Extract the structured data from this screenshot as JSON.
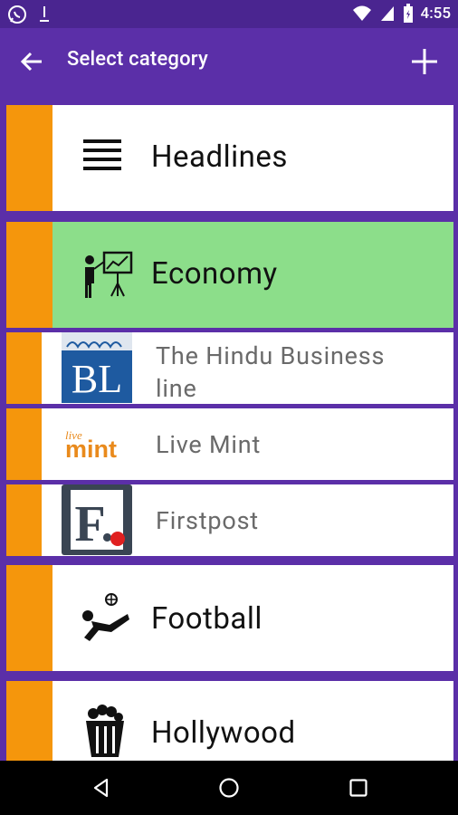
{
  "status_bar": {
    "time": "4:55",
    "icons": [
      "whatsapp-icon",
      "download-icon",
      "wifi-icon",
      "signal-icon",
      "battery-icon"
    ]
  },
  "app_bar": {
    "title": "Select category",
    "back_icon": "arrow-left-icon",
    "add_icon": "plus-icon"
  },
  "colors": {
    "primary": "#5b2fa8",
    "status_bar": "#4a2590",
    "accent_bar": "#f5960c",
    "selected_bg": "#8cde8a"
  },
  "categories": [
    {
      "label": "Headlines",
      "icon": "list-lines-icon"
    },
    {
      "label": "Economy",
      "icon": "presenter-chart-icon",
      "selected": true
    },
    {
      "label": "Football",
      "icon": "football-kick-icon"
    },
    {
      "label": "Hollywood",
      "icon": "popcorn-icon"
    }
  ],
  "sources": [
    {
      "label": "The Hindu Business line",
      "logo": "BL",
      "logo_name": "hindu-businessline-logo"
    },
    {
      "label": "Live Mint",
      "logo": "mint",
      "logo_small": "live",
      "logo_name": "livemint-logo"
    },
    {
      "label": "Firstpost",
      "logo": "F.",
      "logo_name": "firstpost-logo"
    }
  ]
}
